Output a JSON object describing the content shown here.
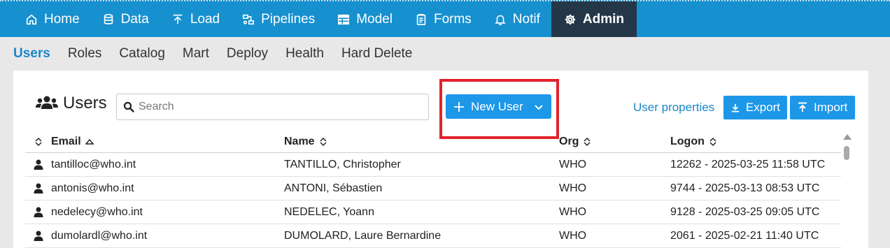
{
  "topnav": {
    "items": [
      {
        "label": "Home",
        "icon": "home-icon"
      },
      {
        "label": "Data",
        "icon": "database-icon"
      },
      {
        "label": "Load",
        "icon": "upload-icon"
      },
      {
        "label": "Pipelines",
        "icon": "pipelines-icon"
      },
      {
        "label": "Model",
        "icon": "table-icon"
      },
      {
        "label": "Forms",
        "icon": "clipboard-icon"
      },
      {
        "label": "Notif",
        "icon": "bell-icon"
      },
      {
        "label": "Admin",
        "icon": "gear-icon",
        "active": true
      }
    ]
  },
  "subnav": {
    "items": [
      "Users",
      "Roles",
      "Catalog",
      "Mart",
      "Deploy",
      "Health",
      "Hard Delete"
    ],
    "active": "Users"
  },
  "panel": {
    "title": "Users",
    "search_placeholder": "Search",
    "new_user_label": "New User",
    "user_properties_label": "User properties",
    "export_label": "Export",
    "import_label": "Import"
  },
  "table": {
    "headers": {
      "email": "Email",
      "name": "Name",
      "org": "Org",
      "logon": "Logon"
    },
    "rows": [
      {
        "email": "tantilloc@who.int",
        "name": "TANTILLO, Christopher",
        "org": "WHO",
        "logon": "12262 - 2025-03-25 11:58 UTC"
      },
      {
        "email": "antonis@who.int",
        "name": "ANTONI, Sébastien",
        "org": "WHO",
        "logon": "9744 - 2025-03-13 08:53 UTC"
      },
      {
        "email": "nedelecy@who.int",
        "name": "NEDELEC, Yoann",
        "org": "WHO",
        "logon": "9128 - 2025-03-25 09:05 UTC"
      },
      {
        "email": "dumolardl@who.int",
        "name": "DUMOLARD, Laure Bernardine",
        "org": "WHO",
        "logon": "2061 - 2025-02-21 11:40 UTC"
      }
    ]
  },
  "colors": {
    "topnav_bg": "#1790cf",
    "active_tab_bg": "#243748",
    "accent": "#1d97e8",
    "link": "#1a86c8",
    "highlight_border": "#e2232d"
  }
}
